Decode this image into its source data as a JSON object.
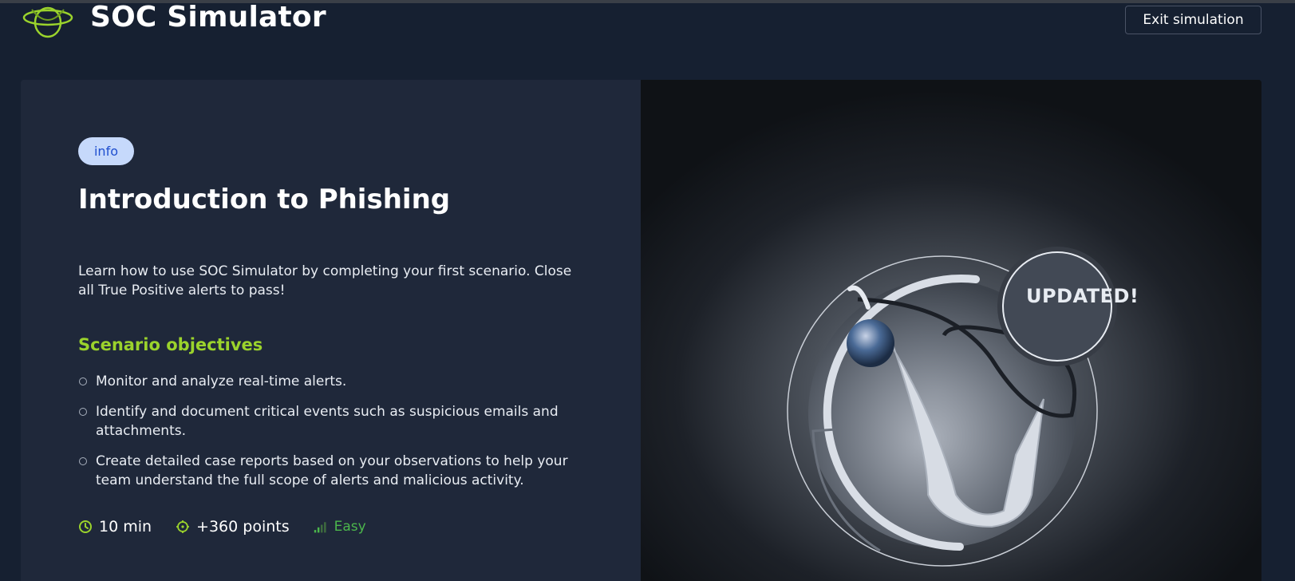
{
  "header": {
    "app_title": "SOC Simulator",
    "exit_label": "Exit simulation"
  },
  "scenario": {
    "badge": "info",
    "title": "Introduction to Phishing",
    "description": "Learn how to use SOC Simulator by completing your first scenario. Close all True Positive alerts to pass!",
    "objectives_heading": "Scenario objectives",
    "objectives": [
      "Monitor and analyze real-time alerts.",
      "Identify and document critical events such as suspicious emails and attachments.",
      "Create detailed case reports based on your observations to help your team understand the full scope of alerts and malicious activity."
    ],
    "duration": "10 min",
    "points": "+360 points",
    "difficulty": "Easy"
  },
  "hero": {
    "updated_label": "UPDATED!"
  },
  "icons": {
    "logo": "soc-simulator-logo",
    "clock": "clock-icon",
    "target": "crosshair-icon",
    "difficulty": "signal-bars-icon"
  },
  "colors": {
    "accent_green": "#9bd32c",
    "easy_green": "#4cb74c",
    "badge_bg": "#c6d9fb",
    "badge_text": "#1f4fcf"
  }
}
